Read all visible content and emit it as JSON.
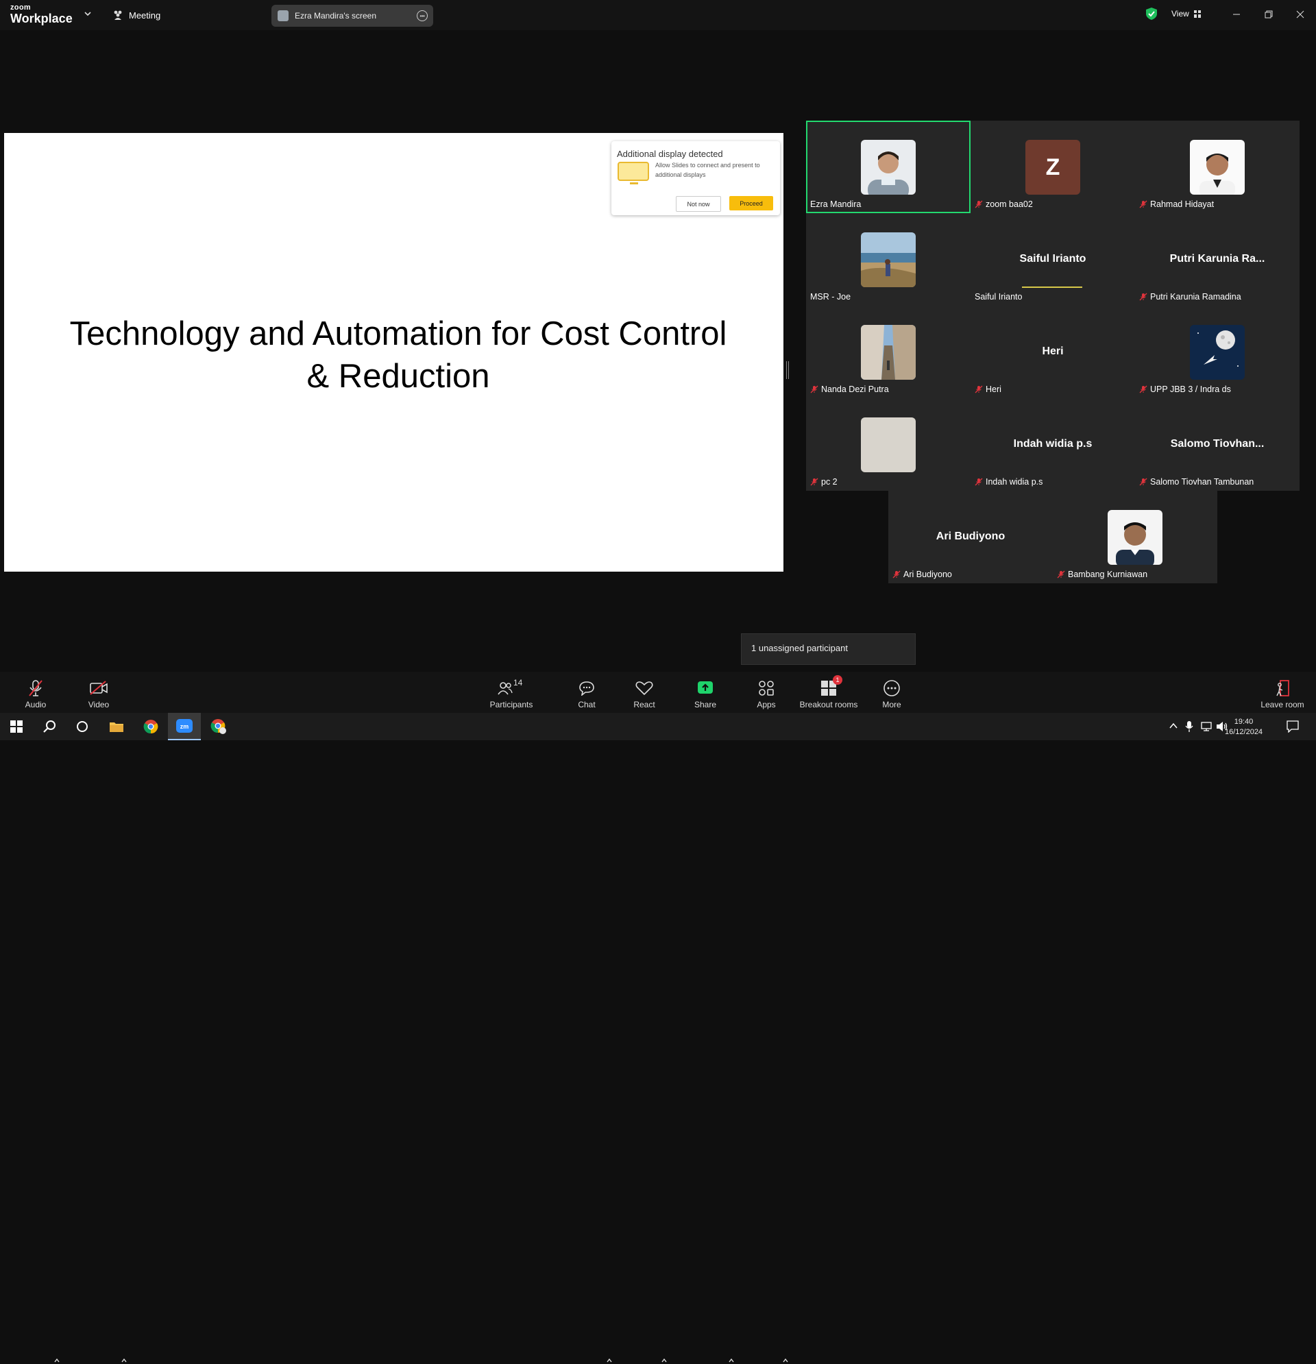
{
  "app": {
    "logo_line1": "zoom",
    "logo_line2": "Workplace"
  },
  "titlebar": {
    "meeting_label": "Meeting",
    "screen_share_label": "Ezra Mandira's screen",
    "view_label": "View"
  },
  "slide": {
    "title_line1": "Technology and Automation for Cost Control",
    "title_line2": "& Reduction",
    "popup": {
      "heading": "Additional display detected",
      "body": "Allow Slides to connect and present to additional displays",
      "not_now": "Not now",
      "proceed": "Proceed"
    }
  },
  "participants": [
    {
      "name": "Ezra Mandira",
      "tile_label": "",
      "muted": false,
      "avatar": "photo-man-smiling",
      "active_speaker": true
    },
    {
      "name": "zoom baa02",
      "tile_label": "Z",
      "muted": true,
      "avatar": "letter-avatar"
    },
    {
      "name": "Rahmad Hidayat",
      "tile_label": "",
      "muted": true,
      "avatar": "photo-man-portrait"
    },
    {
      "name": "MSR - Joe",
      "tile_label": "",
      "muted": false,
      "avatar": "photo-seaside"
    },
    {
      "name": "Saiful Irianto",
      "tile_label": "Saiful Irianto",
      "muted": false,
      "avatar": "none",
      "speaking_indicator": true
    },
    {
      "name": "Putri Karunia Ramadina",
      "tile_label": "Putri  Karunia  Ra...",
      "muted": true,
      "avatar": "none"
    },
    {
      "name": "Nanda Dezi Putra",
      "tile_label": "",
      "muted": true,
      "avatar": "photo-cliff"
    },
    {
      "name": "Heri",
      "tile_label": "Heri",
      "muted": true,
      "avatar": "none"
    },
    {
      "name": "UPP JBB 3 / Indra ds",
      "tile_label": "",
      "muted": true,
      "avatar": "photo-space-moon"
    },
    {
      "name": "pc 2",
      "tile_label": "",
      "muted": true,
      "avatar": "photo-blank-wall"
    },
    {
      "name": "Indah widia p.s",
      "tile_label": "Indah widia p.s",
      "muted": true,
      "avatar": "none"
    },
    {
      "name": "Salomo Tiovhan Tambunan",
      "tile_label": "Salomo  Tiovhan...",
      "muted": true,
      "avatar": "none"
    },
    {
      "name": "Ari Budiyono",
      "tile_label": "Ari Budiyono",
      "muted": true,
      "avatar": "none"
    },
    {
      "name": "Bambang Kurniawan",
      "tile_label": "",
      "muted": true,
      "avatar": "photo-man-formal"
    }
  ],
  "toast": {
    "text": "1 unassigned participant"
  },
  "toolbar": {
    "audio": "Audio",
    "video": "Video",
    "participants": "Participants",
    "participants_count": "14",
    "chat": "Chat",
    "react": "React",
    "share": "Share",
    "apps": "Apps",
    "breakout_rooms": "Breakout rooms",
    "breakout_badge": "1",
    "more": "More",
    "leave": "Leave room"
  },
  "taskbar": {
    "time": "19:40",
    "date": "16/12/2024"
  },
  "colors": {
    "active_speaker": "#23d96f",
    "share_green": "#1fd36b",
    "muted_red": "#e0333c",
    "proceed_yellow": "#f8bd0c"
  }
}
